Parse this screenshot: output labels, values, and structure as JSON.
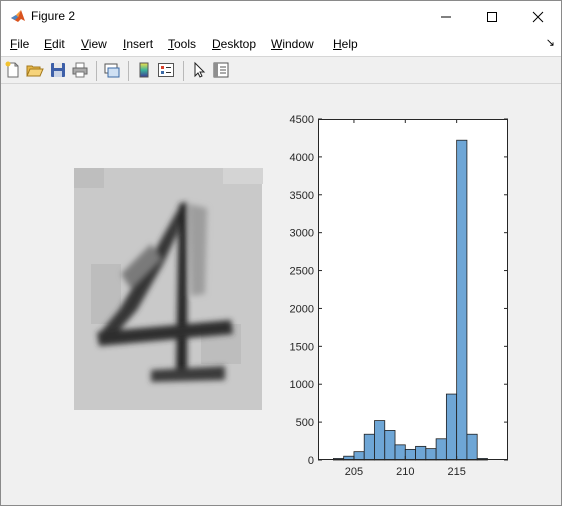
{
  "window": {
    "title": "Figure 2",
    "icon": "matlab-logo-icon"
  },
  "menu": {
    "items": [
      {
        "label": "File",
        "key": "F",
        "rest": "ile"
      },
      {
        "label": "Edit",
        "key": "E",
        "rest": "dit"
      },
      {
        "label": "View",
        "key": "V",
        "rest": "iew"
      },
      {
        "label": "Insert",
        "key": "I",
        "rest": "nsert"
      },
      {
        "label": "Tools",
        "key": "T",
        "rest": "ools"
      },
      {
        "label": "Desktop",
        "key": "D",
        "rest": "esktop"
      },
      {
        "label": "Window",
        "key": "W",
        "rest": "indow"
      },
      {
        "label": "Help",
        "key": "H",
        "rest": "elp"
      }
    ],
    "dock_arrow": "↘"
  },
  "toolbar": {
    "buttons": [
      "new-figure-icon",
      "open-file-icon",
      "save-icon",
      "print-icon",
      "link-icon",
      "colorbar-icon",
      "legend-icon",
      "pointer-icon",
      "property-inspector-icon"
    ]
  },
  "image_panel": {
    "subject": "handwritten digit 4 (grayscale)"
  },
  "chart_data": {
    "type": "bar",
    "title": "",
    "xlabel": "",
    "ylabel": "",
    "bin_width": 1,
    "bin_edges_start": 203,
    "values": [
      20,
      50,
      110,
      340,
      520,
      390,
      200,
      140,
      180,
      150,
      280,
      870,
      4220,
      340,
      20
    ],
    "xlim": [
      201.5,
      220
    ],
    "ylim": [
      0,
      4500
    ],
    "xticks": [
      205,
      210,
      215
    ],
    "yticks": [
      0,
      500,
      1000,
      1500,
      2000,
      2500,
      3000,
      3500,
      4000,
      4500
    ],
    "bar_color": "#6ea6d6",
    "grid": false
  }
}
